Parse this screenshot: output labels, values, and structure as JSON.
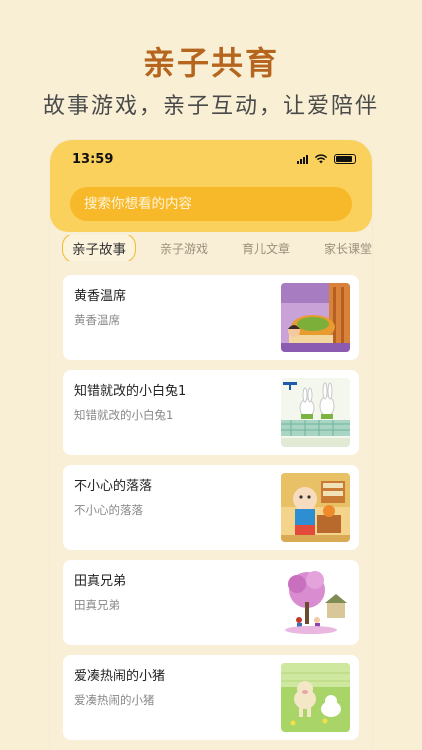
{
  "promo": {
    "title": "亲子共育",
    "subtitle": "故事游戏，亲子互动，让爱陪伴"
  },
  "status_bar": {
    "time": "13:59"
  },
  "search": {
    "placeholder": "搜索你想看的内容"
  },
  "tabs": [
    {
      "label": "亲子故事",
      "active": true
    },
    {
      "label": "亲子游戏",
      "active": false
    },
    {
      "label": "育儿文章",
      "active": false
    },
    {
      "label": "家长课堂",
      "active": false
    }
  ],
  "stories": [
    {
      "title": "黄香温席",
      "desc": "黄香温席"
    },
    {
      "title": "知错就改的小白兔1",
      "desc": "知错就改的小白兔1"
    },
    {
      "title": "不小心的落落",
      "desc": "不小心的落落"
    },
    {
      "title": "田真兄弟",
      "desc": "田真兄弟"
    },
    {
      "title": "爱凑热闹的小猪",
      "desc": "爱凑热闹的小猪"
    }
  ],
  "colors": {
    "background": "#f8efd5",
    "header": "#fbd15e",
    "search_bg": "#f7b92a",
    "title_accent": "#b5651d",
    "active_tab_border": "#f3b933"
  }
}
